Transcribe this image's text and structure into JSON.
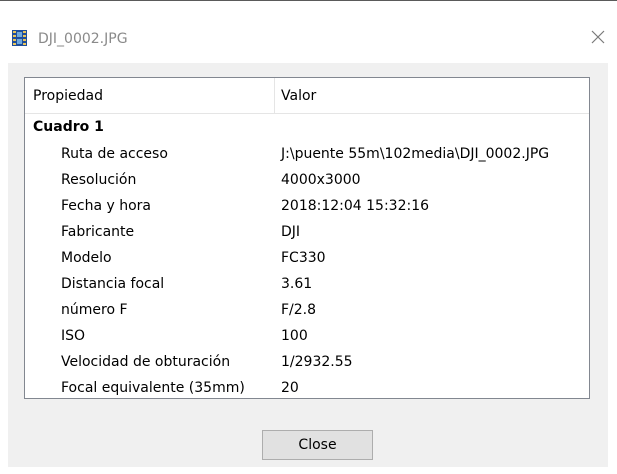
{
  "window": {
    "title": "DJI_0002.JPG",
    "icon": "film-strip-icon"
  },
  "list": {
    "columns": [
      "Propiedad",
      "Valor"
    ],
    "group": "Cuadro 1",
    "rows": [
      {
        "name": "Ruta de acceso",
        "value": "J:\\puente 55m\\102media\\DJI_0002.JPG"
      },
      {
        "name": "Resolución",
        "value": "4000x3000"
      },
      {
        "name": "Fecha y hora",
        "value": "2018:12:04 15:32:16"
      },
      {
        "name": "Fabricante",
        "value": "DJI"
      },
      {
        "name": "Modelo",
        "value": "FC330"
      },
      {
        "name": "Distancia focal",
        "value": "3.61"
      },
      {
        "name": "número F",
        "value": "F/2.8"
      },
      {
        "name": "ISO",
        "value": "100"
      },
      {
        "name": "Velocidad de obturación",
        "value": "1/2932.55"
      },
      {
        "name": "Focal equivalente (35mm)",
        "value": "20"
      }
    ]
  },
  "buttons": {
    "close_label": "Close"
  }
}
